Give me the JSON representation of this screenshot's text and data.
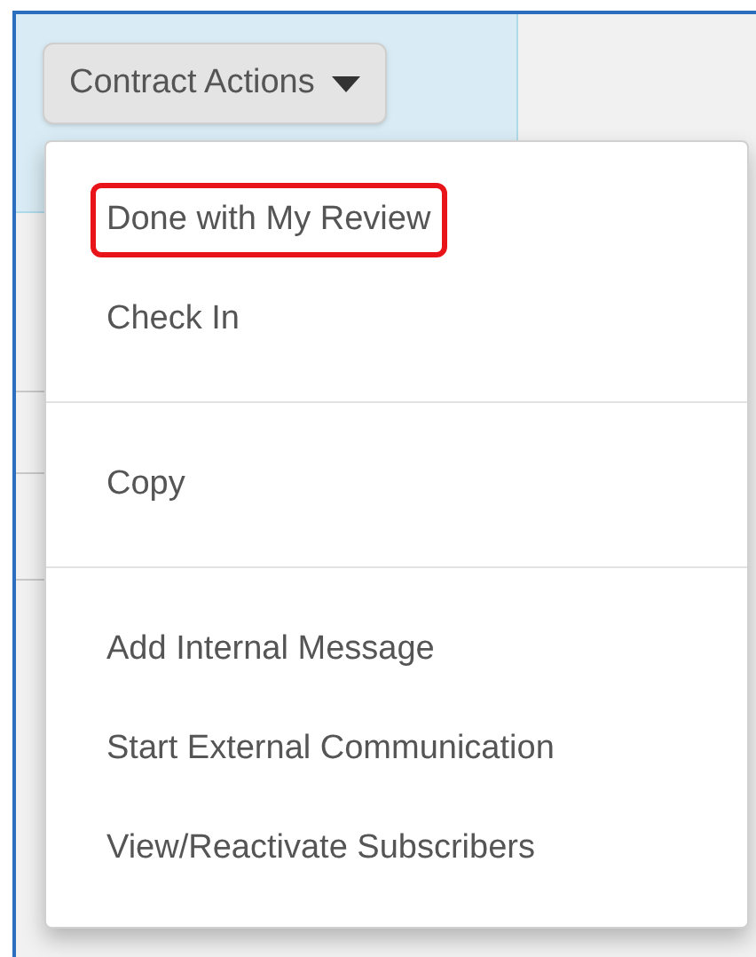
{
  "button": {
    "label": "Contract Actions"
  },
  "menu": {
    "sections": [
      {
        "items": [
          {
            "label": "Done with My Review",
            "highlighted": true
          },
          {
            "label": "Check In",
            "highlighted": false
          }
        ]
      },
      {
        "items": [
          {
            "label": "Copy",
            "highlighted": false
          }
        ]
      },
      {
        "items": [
          {
            "label": "Add Internal Message",
            "highlighted": false
          },
          {
            "label": "Start External Communication",
            "highlighted": false
          },
          {
            "label": "View/Reactivate Subscribers",
            "highlighted": false
          }
        ]
      }
    ]
  }
}
